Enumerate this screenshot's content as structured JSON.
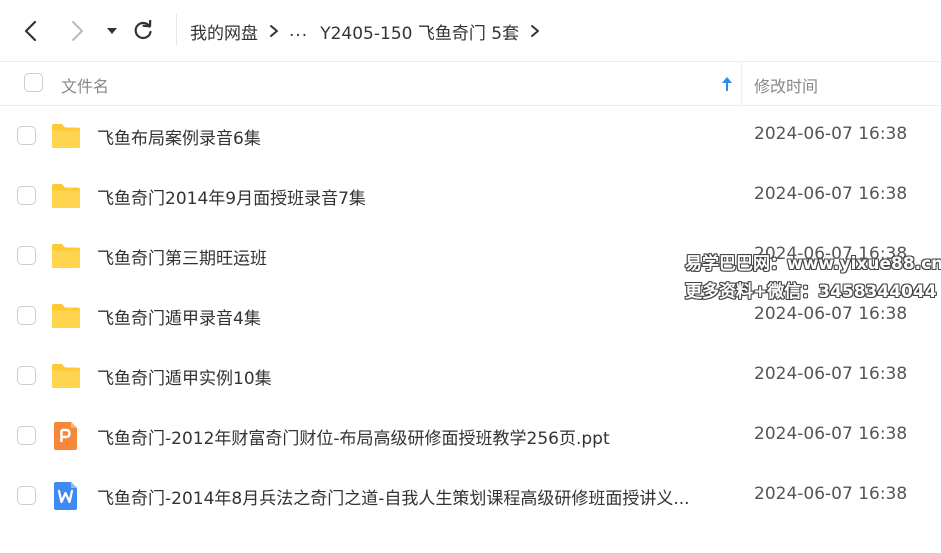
{
  "breadcrumb": {
    "root": "我的网盘",
    "ellipsis": "...",
    "current": "Y2405-150 飞鱼奇门 5套"
  },
  "header": {
    "name_label": "文件名",
    "time_label": "修改时间",
    "sort_icon": "arrow-up-icon"
  },
  "files": [
    {
      "name": "飞鱼布局案例录音6集",
      "time": "2024-06-07 16:38",
      "type": "folder"
    },
    {
      "name": "飞鱼奇门2014年9月面授班录音7集",
      "time": "2024-06-07 16:38",
      "type": "folder"
    },
    {
      "name": "飞鱼奇门第三期旺运班",
      "time": "2024-06-07 16:38",
      "type": "folder"
    },
    {
      "name": "飞鱼奇门遁甲录音4集",
      "time": "2024-06-07 16:38",
      "type": "folder"
    },
    {
      "name": "飞鱼奇门遁甲实例10集",
      "time": "2024-06-07 16:38",
      "type": "folder"
    },
    {
      "name": "飞鱼奇门-2012年财富奇门财位-布局高级研修面授班教学256页.ppt",
      "time": "2024-06-07 16:38",
      "type": "ppt"
    },
    {
      "name": "飞鱼奇门-2014年8月兵法之奇门之道-自我人生策划课程高级研修班面授讲义...",
      "time": "2024-06-07 16:38",
      "type": "word"
    }
  ],
  "watermark": {
    "line1": "易学巴巴网：www.yixue88.cn",
    "line2": "更多资料+微信：3458344044"
  },
  "colors": {
    "folder": "#FFC933",
    "ppt": "#F5883B",
    "word": "#3D8BF2",
    "sort_arrow": "#2B8CF0"
  }
}
